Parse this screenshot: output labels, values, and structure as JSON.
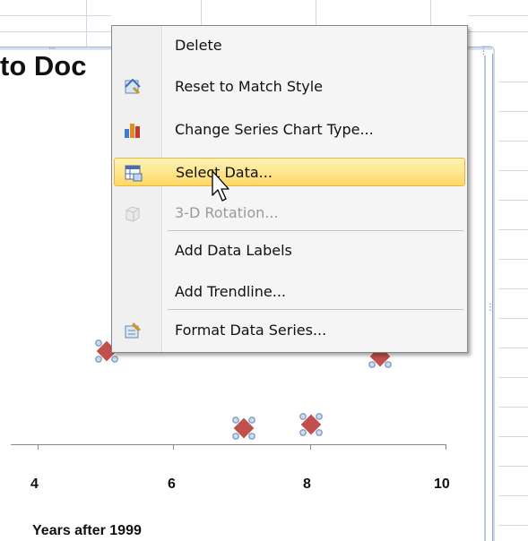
{
  "chart": {
    "title_fragment": "to Doc",
    "x_tick_labels": [
      "4",
      "6",
      "8",
      "10"
    ],
    "x_axis_title": "Years after 1999"
  },
  "context_menu": {
    "items": [
      {
        "label": "Delete",
        "icon": "none"
      },
      {
        "label": "Reset to Match Style",
        "icon": "reset-style-icon"
      },
      {
        "label": "Change Series Chart Type...",
        "icon": "chart-type-icon"
      },
      {
        "label": "Select Data...",
        "icon": "select-data-icon",
        "highlighted": true
      },
      {
        "label": "3-D Rotation...",
        "icon": "3d-rotation-icon",
        "disabled": true
      },
      {
        "label": "Add Data Labels",
        "icon": "none"
      },
      {
        "label": "Add Trendline...",
        "icon": "none"
      },
      {
        "label": "Format Data Series...",
        "icon": "format-series-icon"
      }
    ]
  },
  "colors": {
    "marker_fill": "#c0504d",
    "selection_handle": "#7f9ec4",
    "menu_highlight": "#ffd865",
    "grid_line": "#d0d7e5"
  }
}
